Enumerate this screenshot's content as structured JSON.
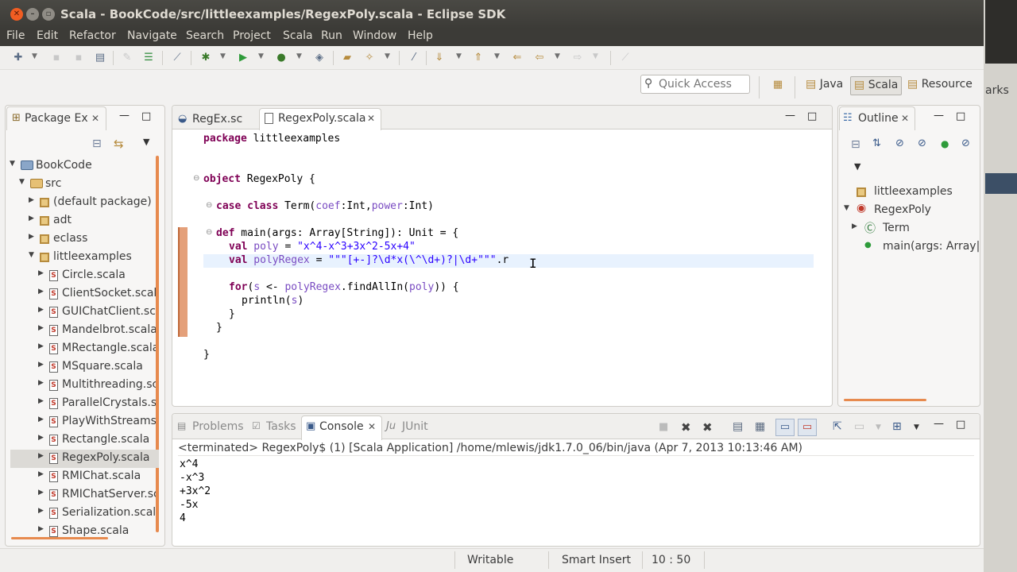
{
  "window": {
    "title": "Scala - BookCode/src/littleexamples/RegexPoly.scala - Eclipse SDK"
  },
  "menu": [
    "File",
    "Edit",
    "Refactor",
    "Navigate",
    "Search",
    "Project",
    "Scala",
    "Run",
    "Window",
    "Help"
  ],
  "quick_access": {
    "placeholder": "Quick Access"
  },
  "perspectives": [
    "Java",
    "Scala",
    "Resource"
  ],
  "background_window_text": "arks",
  "package_explorer": {
    "tab": "Package Ex",
    "project": "BookCode",
    "src": "src",
    "packages": [
      "(default package)",
      "adt",
      "eclass",
      "littleexamples"
    ],
    "files": [
      "Circle.scala",
      "ClientSocket.scala",
      "GUIChatClient.sca",
      "Mandelbrot.scala",
      "MRectangle.scala",
      "MSquare.scala",
      "Multithreading.sc",
      "ParallelCrystals.sc",
      "PlayWithStreams.sc",
      "Rectangle.scala",
      "RegexPoly.scala",
      "RMIChat.scala",
      "RMIChatServer.sca",
      "Serialization.scala",
      "Shape.scala"
    ],
    "selected_file": "RegexPoly.scala"
  },
  "editor": {
    "tabs": [
      "RegEx.sc",
      "RegexPoly.scala"
    ],
    "active_tab": "RegexPoly.scala",
    "code": {
      "l1_kw": "package",
      "l1_rest": " littleexamples",
      "l2_kw": "object",
      "l2_rest": " RegexPoly {",
      "l3_kw": "case class",
      "l3_a": " Term(",
      "l3_v1": "coef",
      "l3_b": ":Int,",
      "l3_v2": "power",
      "l3_c": ":Int)",
      "l4_kw": "def",
      "l4_rest": " main(args: Array[String]): Unit = {",
      "l5_kw": "val",
      "l5_v": " poly",
      "l5_eq": " = ",
      "l5_str": "\"x^4-x^3+3x^2-5x+4\"",
      "l6_kw": "val",
      "l6_v": " polyRegex",
      "l6_eq": " = ",
      "l6_str": "\"\"\"[+-]?\\d*x(\\^\\d+)?|\\d+\"\"\"",
      "l6_rest": ".r",
      "l7_kw": "for",
      "l7_a": "(",
      "l7_v1": "s",
      "l7_b": " <- ",
      "l7_v2": "polyRegex",
      "l7_c": ".findAllIn(",
      "l7_v3": "poly",
      "l7_d": ")) {",
      "l8_a": "println(",
      "l8_v": "s",
      "l8_b": ")",
      "l9": "}",
      "l10": "}",
      "l11": "}"
    }
  },
  "outline": {
    "tab": "Outline",
    "items": [
      "littleexamples",
      "RegexPoly",
      "Term",
      "main(args: Array|"
    ]
  },
  "bottom": {
    "tabs": [
      "Problems",
      "Tasks",
      "Console",
      "JUnit"
    ],
    "active_tab": "Console",
    "console_header": "<terminated> RegexPoly$ (1) [Scala Application] /home/mlewis/jdk1.7.0_06/bin/java (Apr 7, 2013 10:13:46 AM)",
    "output": [
      "x^4",
      "-x^3",
      "+3x^2",
      "-5x",
      "4"
    ]
  },
  "status": {
    "writable": "Writable",
    "insert_mode": "Smart Insert",
    "position": "10 : 50"
  }
}
